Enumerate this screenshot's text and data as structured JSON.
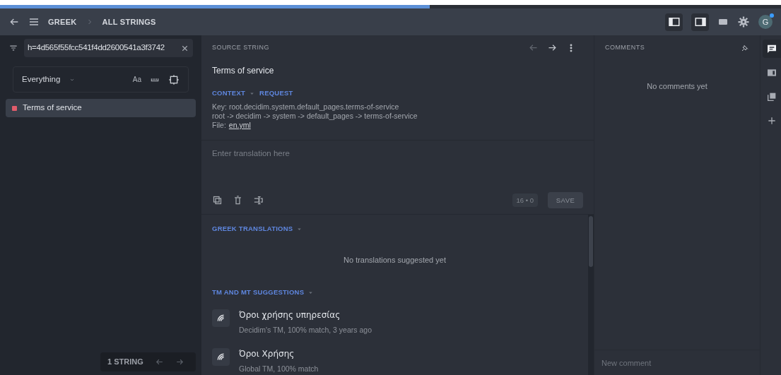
{
  "progress": {
    "level": 0.55
  },
  "header": {
    "breadcrumb": [
      "GREEK",
      "ALL STRINGS"
    ],
    "layout_toggles": [
      {
        "selected": true
      },
      {
        "selected": true
      }
    ],
    "avatar": "G",
    "avatar_notification": true
  },
  "sidebar": {
    "search": {
      "value": "h=4d565f55fcc541f4dd2600541a3f3742"
    },
    "filter": {
      "value": "Everything",
      "case_label": "Aa"
    },
    "strings": [
      {
        "label": "Terms of service",
        "selected": true,
        "color": "#e05c6b"
      }
    ],
    "footer": {
      "count": "1 STRING"
    }
  },
  "source": {
    "heading": "SOURCE STRING",
    "text": "Terms of service",
    "tabs": [
      {
        "label": "CONTEXT",
        "dropdown": true
      },
      {
        "label": "REQUEST",
        "dropdown": false
      }
    ],
    "key_line": "Key: root.decidim.system.default_pages.terms-of-service",
    "path_line": "root -> decidim -> system -> default_pages -> terms-of-service",
    "file_label": "File:",
    "file_link": "en.yml"
  },
  "editor": {
    "placeholder": "Enter translation here",
    "counter": "16 • 0",
    "save": {
      "label": "SAVE",
      "disabled": true
    }
  },
  "translations": {
    "heading": "GREEK TRANSLATIONS",
    "empty": "No translations suggested yet"
  },
  "suggestions": {
    "heading": "TM AND MT SUGGESTIONS",
    "items": [
      {
        "text": "Όροι χρήσης υπηρεσίας",
        "meta": "Decidim's TM, 100% match, 3 years ago"
      },
      {
        "text": "Όροι Χρήσης",
        "meta": "Global TM, 100% match"
      }
    ]
  },
  "comments": {
    "heading": "COMMENTS",
    "empty": "No comments yet",
    "placeholder": "New comment"
  },
  "rail": [
    {
      "kind": "comments",
      "selected": true
    },
    {
      "kind": "panel",
      "selected": false
    },
    {
      "kind": "copy",
      "selected": false
    },
    {
      "kind": "add",
      "selected": false
    }
  ]
}
